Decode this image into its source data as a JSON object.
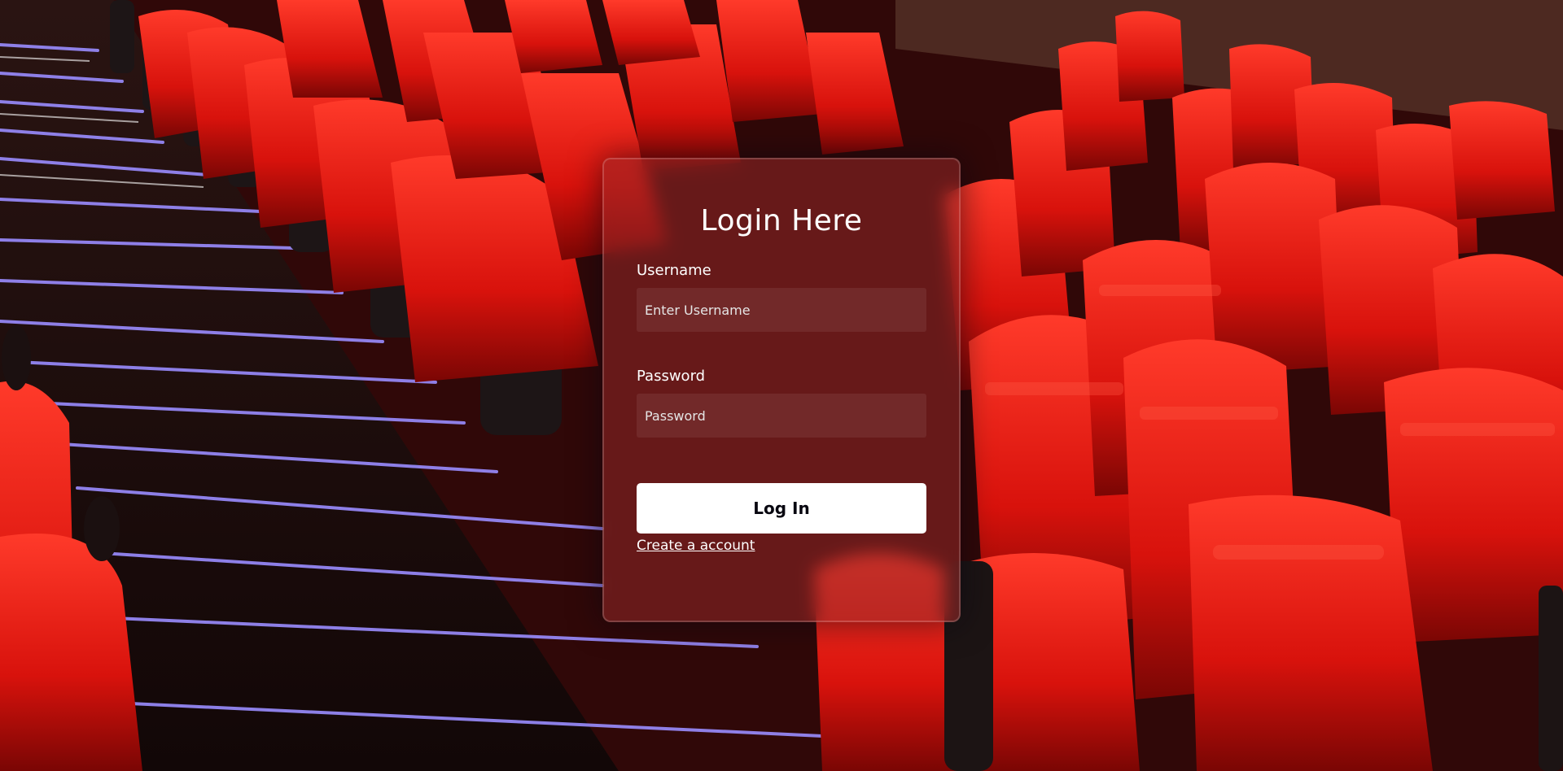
{
  "login": {
    "title": "Login Here",
    "username_label": "Username",
    "username_placeholder": "Enter Username",
    "username_value": "",
    "password_label": "Password",
    "password_placeholder": "Password",
    "password_value": "",
    "submit_label": "Log In",
    "create_account_link": "Create a account"
  },
  "background": {
    "scene": "cinema-seats-image",
    "seat_color": "#c8100c",
    "stair_light_color": "#7f6cff"
  }
}
